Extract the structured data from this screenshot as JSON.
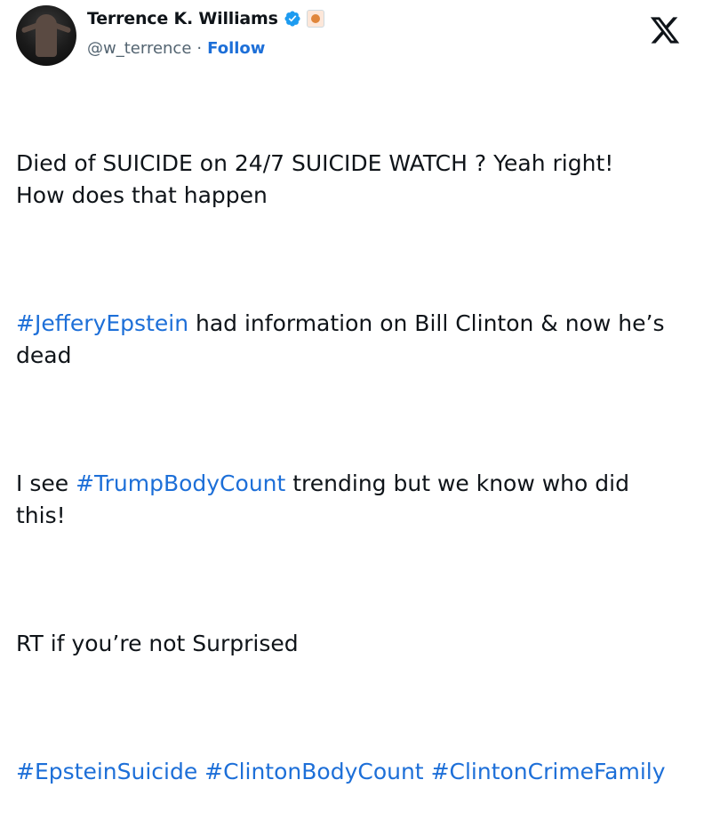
{
  "author": {
    "name": "Terrence K. Williams",
    "handle": "@w_terrence",
    "separator": "·",
    "follow_label": "Follow"
  },
  "icons": {
    "verified": "verified-badge-icon",
    "affiliate": "affiliate-badge-icon",
    "brand": "x-logo-icon"
  },
  "colors": {
    "link": "#1d6fd8",
    "verified": "#1d9bf0",
    "text": "#0f1419",
    "muted": "#536471"
  },
  "tweet": {
    "p1": "Died of SUICIDE on 24/7 SUICIDE WATCH ? Yeah right!\nHow does that happen",
    "p2_tag": "#JefferyEpstein",
    "p2_text": " had information on Bill Clinton & now he’s\ndead",
    "p3_pre": "I see ",
    "p3_tag": "#TrumpBodyCount",
    "p3_text": " trending but we know who did\nthis!",
    "p4": "RT if you’re not Surprised",
    "tag1": "#EpsteinSuicide",
    "tag2": "#ClintonBodyCount",
    "tag3": "#ClintonCrimeFamily"
  }
}
